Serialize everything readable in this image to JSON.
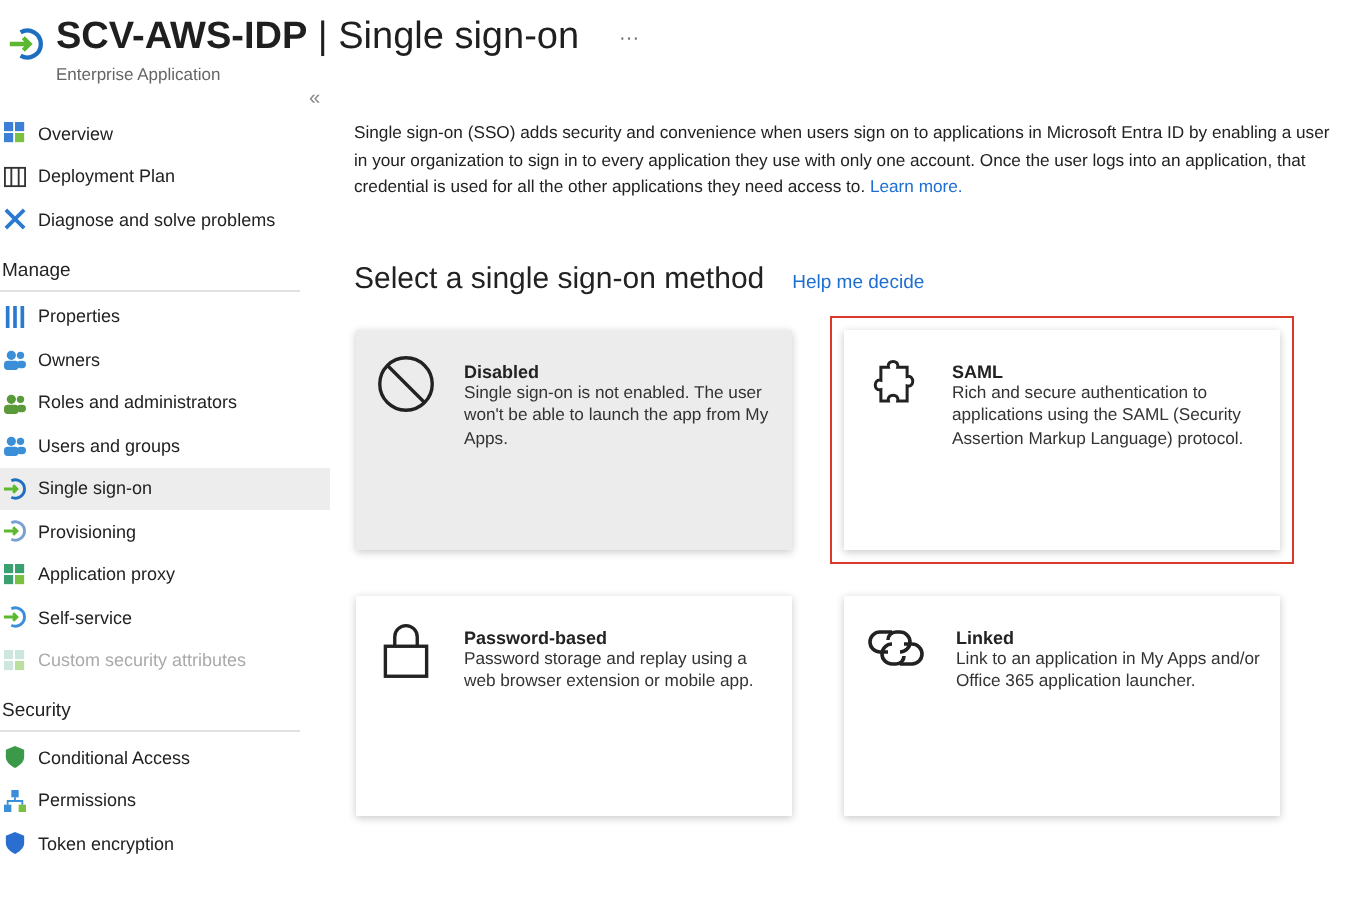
{
  "header": {
    "title_app": "SCV-AWS-IDP",
    "title_separator": "|",
    "title_page": "Single sign-on",
    "subtitle": "Enterprise Application",
    "more": "···"
  },
  "sidebar": {
    "collapse": "«",
    "sections": [
      {
        "items": [
          {
            "label": "Overview",
            "selected": false,
            "disabled": false
          },
          {
            "label": "Deployment Plan",
            "selected": false,
            "disabled": false
          },
          {
            "label": "Diagnose and solve problems",
            "selected": false,
            "disabled": false
          }
        ]
      },
      {
        "heading": "Manage",
        "items": [
          {
            "label": "Properties",
            "selected": false,
            "disabled": false
          },
          {
            "label": "Owners",
            "selected": false,
            "disabled": false
          },
          {
            "label": "Roles and administrators",
            "selected": false,
            "disabled": false
          },
          {
            "label": "Users and groups",
            "selected": false,
            "disabled": false
          },
          {
            "label": "Single sign-on",
            "selected": true,
            "disabled": false
          },
          {
            "label": "Provisioning",
            "selected": false,
            "disabled": false
          },
          {
            "label": "Application proxy",
            "selected": false,
            "disabled": false
          },
          {
            "label": "Self-service",
            "selected": false,
            "disabled": false
          },
          {
            "label": "Custom security attributes",
            "selected": false,
            "disabled": true
          }
        ]
      },
      {
        "heading": "Security",
        "items": [
          {
            "label": "Conditional Access",
            "selected": false,
            "disabled": false
          },
          {
            "label": "Permissions",
            "selected": false,
            "disabled": false
          },
          {
            "label": "Token encryption",
            "selected": false,
            "disabled": false
          }
        ]
      }
    ]
  },
  "intro": {
    "text": "Single sign-on (SSO) adds security and convenience when users sign on to applications in Microsoft Entra ID by enabling a user in your organization to sign in to every application they use with only one account. Once the user logs into an application, that credential is used for all the other applications they need access to.",
    "link": "Learn more."
  },
  "methods_title": "Select a single sign-on method",
  "help_link": "Help me decide",
  "methods": [
    {
      "kind": "disabled",
      "title": "Disabled",
      "description": "Single sign-on is not enabled. The user won't be able to launch the app from My Apps.",
      "selected": true,
      "highlighted": false
    },
    {
      "kind": "saml",
      "title": "SAML",
      "description": "Rich and secure authentication to applications using the SAML (Security Assertion Markup Language) protocol.",
      "selected": false,
      "highlighted": true
    },
    {
      "kind": "password",
      "title": "Password-based",
      "description": "Password storage and replay using a web browser extension or mobile app.",
      "selected": false,
      "highlighted": false
    },
    {
      "kind": "linked",
      "title": "Linked",
      "description": "Link to an application in My Apps and/or Office 365 application launcher.",
      "selected": false,
      "highlighted": false
    }
  ]
}
